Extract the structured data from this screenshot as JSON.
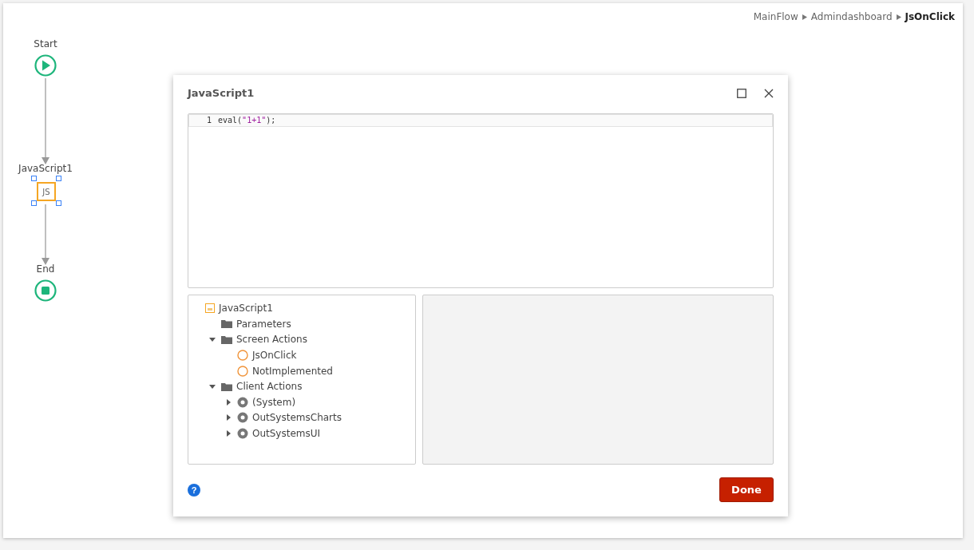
{
  "breadcrumb": [
    {
      "label": "MainFlow",
      "current": false
    },
    {
      "label": "Admindashboard",
      "current": false
    },
    {
      "label": "JsOnClick",
      "current": true
    }
  ],
  "flow": {
    "nodes": [
      {
        "kind": "start",
        "label": "Start"
      },
      {
        "kind": "js",
        "label": "JavaScript1",
        "icon_text": "JS",
        "selected": true
      },
      {
        "kind": "end",
        "label": "End"
      }
    ]
  },
  "dialog": {
    "title": "JavaScript1",
    "code_lines": [
      {
        "number": "1",
        "parts": [
          {
            "kind": "plain",
            "text": "eval("
          },
          {
            "kind": "string",
            "text": "\"1+1\""
          },
          {
            "kind": "plain",
            "text": ");"
          }
        ]
      }
    ],
    "tree": [
      {
        "kind": "js",
        "label": "JavaScript1",
        "children": [
          {
            "kind": "folder",
            "label": "Parameters"
          },
          {
            "kind": "folder",
            "label": "Screen Actions",
            "expanded": true,
            "children": [
              {
                "kind": "action",
                "label": "JsOnClick"
              },
              {
                "kind": "action",
                "label": "NotImplemented"
              }
            ]
          },
          {
            "kind": "folder",
            "label": "Client Actions",
            "expanded": true,
            "children": [
              {
                "kind": "module",
                "label": "(System)",
                "expanded": false
              },
              {
                "kind": "module",
                "label": "OutSystemsCharts",
                "expanded": false
              },
              {
                "kind": "module",
                "label": "OutSystemsUI",
                "expanded": false
              }
            ]
          }
        ]
      }
    ],
    "help": "?",
    "done_button": "Done"
  }
}
